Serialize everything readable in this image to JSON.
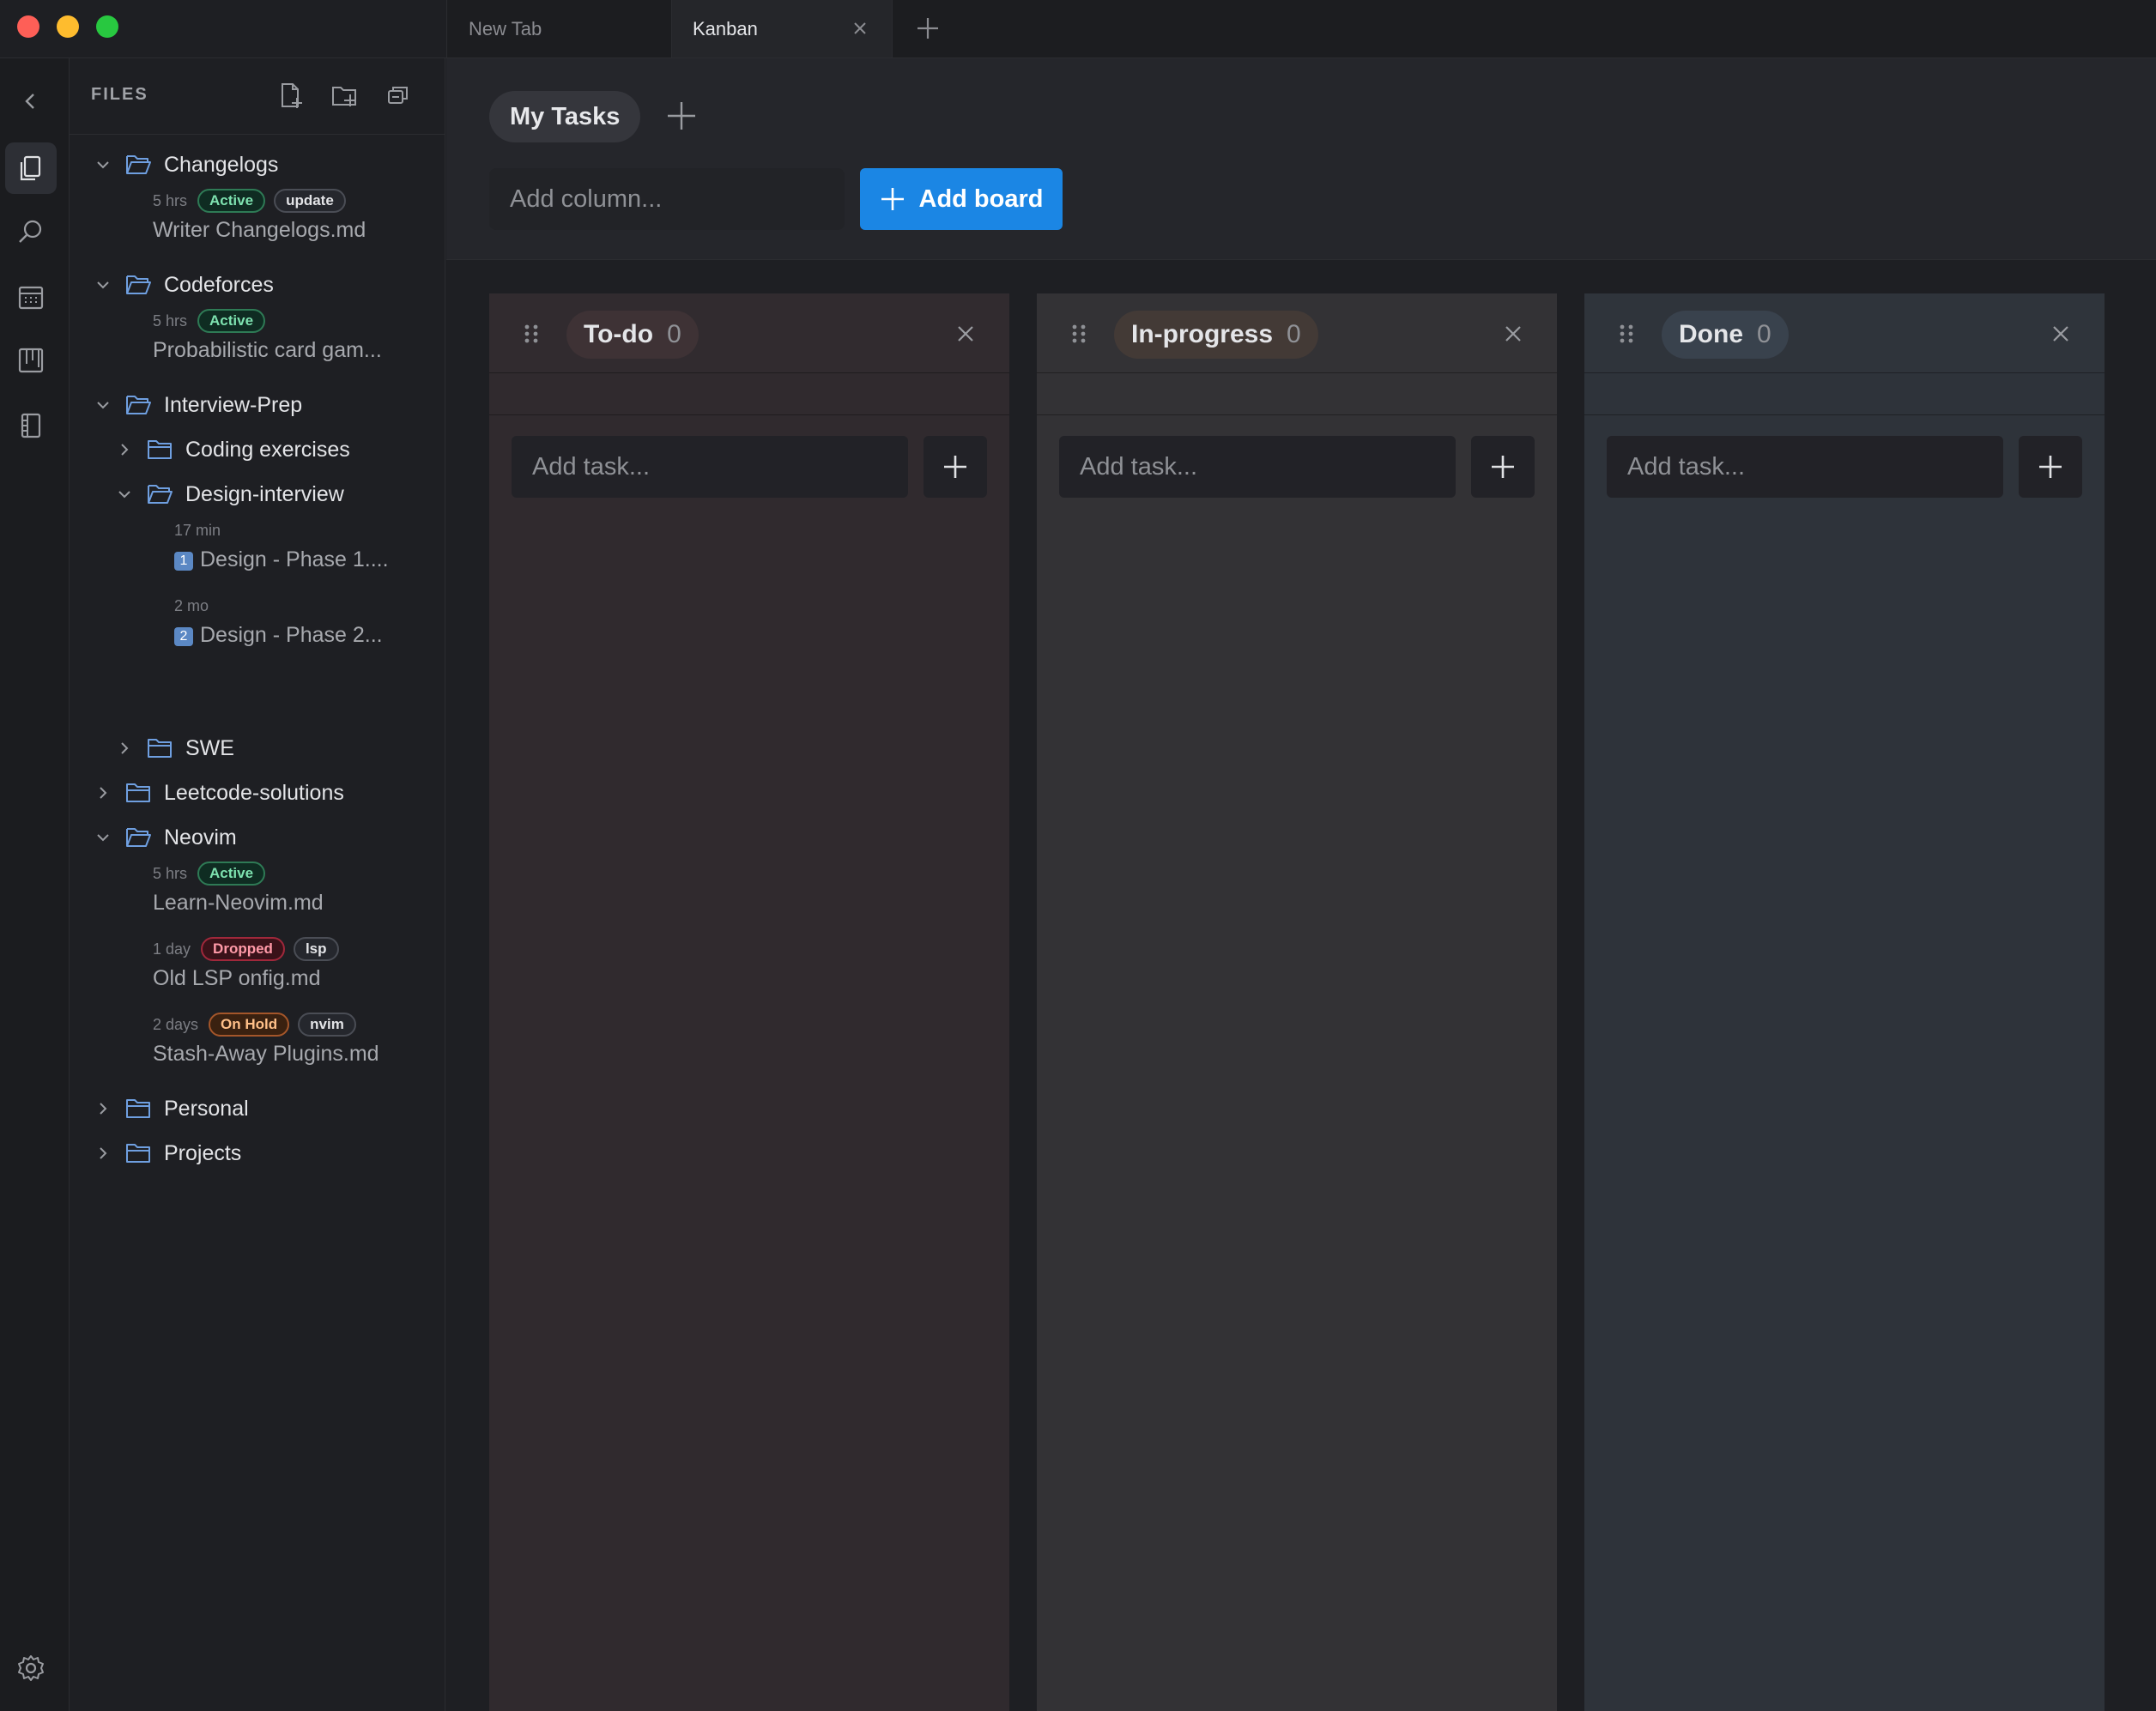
{
  "window": {
    "tabs": [
      {
        "label": "New Tab",
        "active": false
      },
      {
        "label": "Kanban",
        "active": true
      }
    ]
  },
  "files": {
    "title": "FILES",
    "tree": {
      "changelogs": {
        "name": "Changelogs",
        "doc1": {
          "time": "5 hrs",
          "badges": [
            "Active",
            "update"
          ],
          "name": "Writer Changelogs.md"
        }
      },
      "codeforces": {
        "name": "Codeforces",
        "doc1": {
          "time": "5 hrs",
          "badges": [
            "Active"
          ],
          "name": "Probabilistic card gam..."
        }
      },
      "interview": {
        "name": "Interview-Prep",
        "coding": "Coding exercises",
        "design": {
          "name": "Design-interview",
          "doc1": {
            "time": "17 min",
            "num": "1",
            "name": "Design - Phase 1...."
          },
          "doc2": {
            "time": "2 mo",
            "num": "2",
            "name": "Design - Phase 2..."
          }
        },
        "swe": "SWE"
      },
      "leetcode": "Leetcode-solutions",
      "neovim": {
        "name": "Neovim",
        "doc1": {
          "time": "5 hrs",
          "badges": [
            "Active"
          ],
          "name": "Learn-Neovim.md"
        },
        "doc2": {
          "time": "1 day",
          "badges": [
            "Dropped",
            "lsp"
          ],
          "name": "Old LSP onfig.md"
        },
        "doc3": {
          "time": "2 days",
          "badges": [
            "On Hold",
            "nvim"
          ],
          "name": "Stash-Away Plugins.md"
        }
      },
      "personal": "Personal",
      "projects": "Projects"
    }
  },
  "main": {
    "board": "My Tasks",
    "column_input_placeholder": "Add column...",
    "add_board_label": "Add board",
    "columns": [
      {
        "title": "To-do",
        "count": "0",
        "task_placeholder": "Add task..."
      },
      {
        "title": "In-progress",
        "count": "0",
        "task_placeholder": "Add task..."
      },
      {
        "title": "Done",
        "count": "0",
        "task_placeholder": "Add task..."
      }
    ]
  },
  "colors": {
    "accent": "#1b86e4",
    "active_badge": "#7ee2b0",
    "dropped_badge": "#ff9aa8",
    "hold_badge": "#ffc089"
  }
}
